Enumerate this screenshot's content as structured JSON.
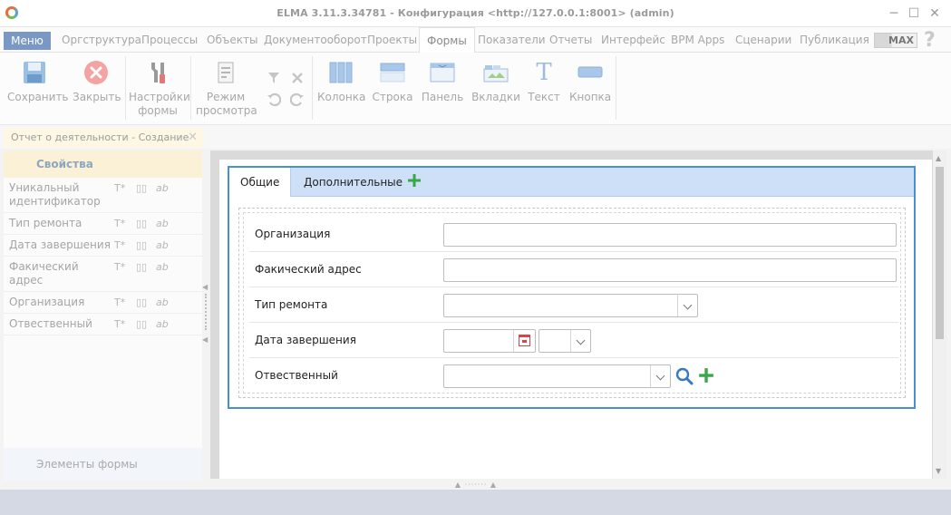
{
  "window": {
    "title": "ELMA 3.11.3.34781 - Конфигурация <http://127.0.0.1:8001> (admin)"
  },
  "menubar": {
    "menu_label": "Меню",
    "tabs": [
      {
        "label": "Оргструктура"
      },
      {
        "label": "Процессы"
      },
      {
        "label": "Объекты"
      },
      {
        "label": "Документооборот"
      },
      {
        "label": "Проекты"
      },
      {
        "label": "Формы",
        "active": true
      },
      {
        "label": "Показатели"
      },
      {
        "label": "Отчеты"
      },
      {
        "label": "Интерфейс"
      },
      {
        "label": "BPM Apps"
      },
      {
        "label": "Сценарии"
      },
      {
        "label": "Публикация"
      }
    ],
    "max_label": "MAX",
    "help_glyph": "?"
  },
  "ribbon": {
    "save": "Сохранить",
    "close": "Закрыть",
    "form_settings": "Настройки формы",
    "preview_mode": "Режим просмотра",
    "column": "Колонка",
    "row": "Строка",
    "panel": "Панель",
    "tabs": "Вкладки",
    "text": "Текст",
    "button": "Кнопка",
    "text_icon_glyph": "T"
  },
  "doc_tab": {
    "label": "Отчет о деятельности - Создание",
    "close_glyph": "✕"
  },
  "properties_panel": {
    "header": "Свойства",
    "items": [
      {
        "name": "Уникальный идентификатор"
      },
      {
        "name": "Тип ремонта"
      },
      {
        "name": "Дата завершения"
      },
      {
        "name": "Факический адрес"
      },
      {
        "name": "Организация"
      },
      {
        "name": "Отвественный"
      }
    ],
    "icon_text_glyph": "T*",
    "icon_field_glyph": "▯▯",
    "icon_ab_glyph": "ab",
    "footer": "Элементы формы"
  },
  "form": {
    "tabs": [
      {
        "label": "Общие",
        "active": true
      },
      {
        "label": "Дополнительные"
      }
    ],
    "fields": [
      {
        "label": "Организация",
        "type": "text"
      },
      {
        "label": "Факический адрес",
        "type": "text"
      },
      {
        "label": "Тип ремонта",
        "type": "dropdown"
      },
      {
        "label": "Дата завершения",
        "type": "date"
      },
      {
        "label": "Отвественный",
        "type": "user"
      }
    ]
  },
  "colors": {
    "accent": "#4a8fd0",
    "menu_button": "#7a98c4",
    "tab_strip": "#cde0f7",
    "add_green": "#3aa64a"
  }
}
